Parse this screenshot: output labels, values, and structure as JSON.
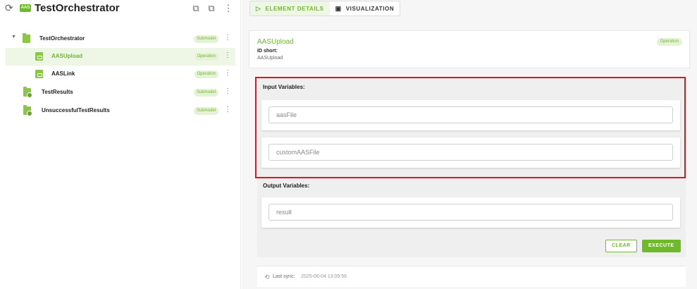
{
  "app": {
    "title": "TestOrchestrator",
    "logo_text": "AAS"
  },
  "tree": [
    {
      "label": "TestOrchestrator",
      "badge": "Submodel",
      "type": "folder",
      "expanded": true,
      "selected": false
    },
    {
      "label": "AASUpload",
      "badge": "Operation",
      "type": "file",
      "selected": true
    },
    {
      "label": "AASLink",
      "badge": "Operation",
      "type": "file",
      "selected": false
    },
    {
      "label": "TestResults",
      "badge": "Submodel",
      "type": "folder-cog",
      "selected": false
    },
    {
      "label": "UnsuccessfulTestResults",
      "badge": "Submodel",
      "type": "folder-cog",
      "selected": false
    }
  ],
  "tabs": [
    {
      "label": "ELEMENT DETAILS",
      "active": true
    },
    {
      "label": "VISUALIZATION",
      "active": false
    }
  ],
  "details": {
    "name": "AASUpload",
    "id_short_label": "ID short:",
    "id_short_value": "AASUpload",
    "badge": "Operation"
  },
  "input_vars": {
    "title": "Input Variables:",
    "fields": [
      {
        "placeholder": "aasFile"
      },
      {
        "placeholder": "customAASFile"
      }
    ]
  },
  "output_vars": {
    "title": "Output Variables:",
    "fields": [
      {
        "placeholder": "result"
      }
    ]
  },
  "buttons": {
    "clear": "CLEAR",
    "execute": "EXECUTE"
  },
  "sync": {
    "label": "Last sync:",
    "value": "2025-06-04 13:09:56"
  },
  "colors": {
    "accent": "#6fb92a",
    "highlight": "#e01414"
  }
}
